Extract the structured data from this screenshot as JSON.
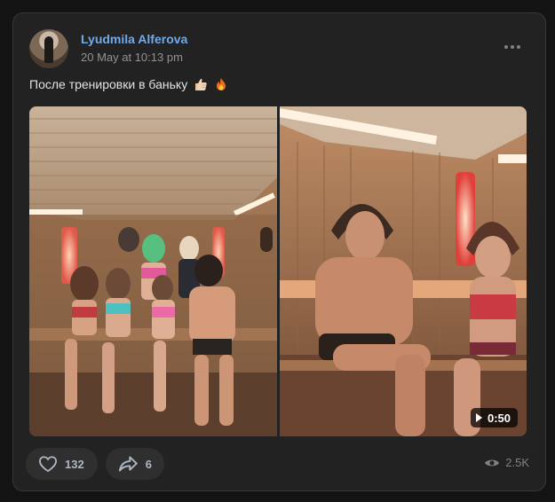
{
  "post": {
    "author": "Lyudmila Alferova",
    "date": "20 May at 10:13 pm",
    "text": "После тренировки в баньку",
    "emojis": [
      "thumbs-up-icon",
      "fire-icon"
    ]
  },
  "media": {
    "items": [
      {
        "type": "photo",
        "description": "sauna-group-photo"
      },
      {
        "type": "video",
        "duration": "0:50"
      }
    ]
  },
  "footer": {
    "likes": "132",
    "shares": "6",
    "views": "2.5K"
  },
  "colors": {
    "background": "#141414",
    "card": "#222222",
    "author_link": "#71aaeb",
    "muted": "#939393",
    "pill": "#2f2f2f"
  }
}
